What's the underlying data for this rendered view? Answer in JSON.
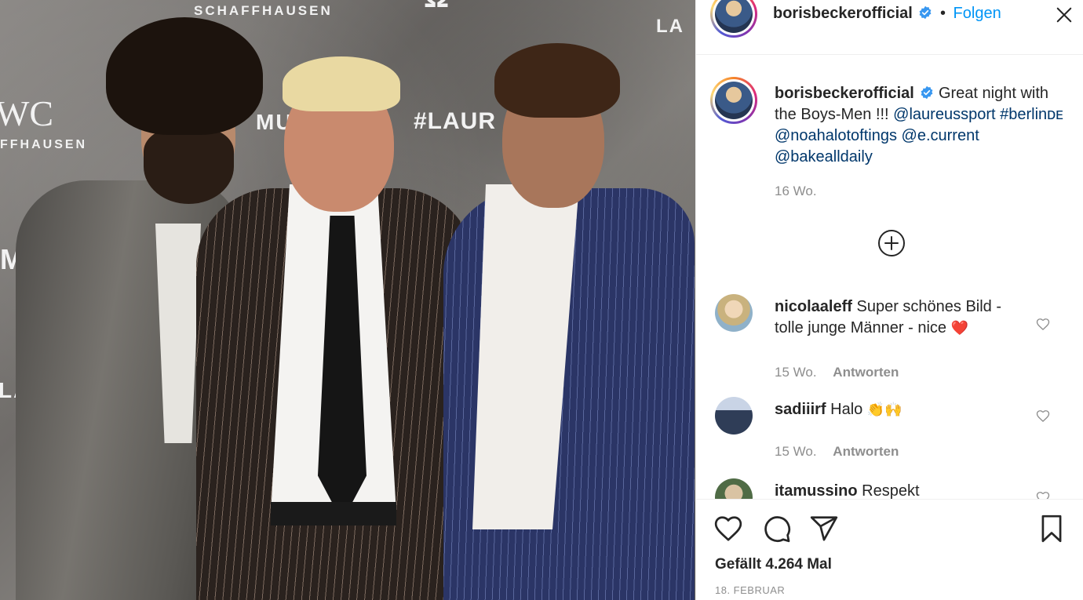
{
  "photo": {
    "backdrop_texts": [
      "SCHAFFHAUSEN",
      "WC",
      "FFHAUSEN",
      "#LAUR",
      "MU",
      "MU",
      "LAUR",
      "Ω",
      "LA"
    ]
  },
  "post": {
    "username": "borisbeckerofficial",
    "separator": "•",
    "follow_label": "Folgen",
    "caption_lead": "Great night with the Boys-Men !!! ",
    "caption_tags": [
      "@laureussport",
      "#berlinᴅᴇ",
      "@noahalotoftings",
      "@e.current",
      "@bakealldaily"
    ],
    "caption_time": "16 Wo.",
    "likes_text": "Gefällt 4.264 Mal",
    "date_text": "18. FEBRUAR"
  },
  "comments": [
    {
      "user": "nicolaaleff",
      "text": "Super schönes Bild - tolle junge Männer - nice",
      "emoji": "❤️",
      "time": "15 Wo.",
      "reply": "Antworten"
    },
    {
      "user": "sadiiirf",
      "text": "Halo",
      "emoji": "👏🙌",
      "time": "15 Wo.",
      "reply": "Antworten"
    },
    {
      "user": "itamussino",
      "text": "Respekt",
      "emoji": "",
      "time": "",
      "reply": ""
    }
  ],
  "colors": {
    "link": "#00376b",
    "follow": "#0095f6",
    "muted": "#8e8e8e",
    "verified": "#3897f0",
    "heart_emoji": "#e0245e"
  },
  "icons": [
    "close-icon",
    "add-comments-icon",
    "heart-icon",
    "comment-icon",
    "share-icon",
    "bookmark-icon",
    "verified-badge-icon"
  ]
}
